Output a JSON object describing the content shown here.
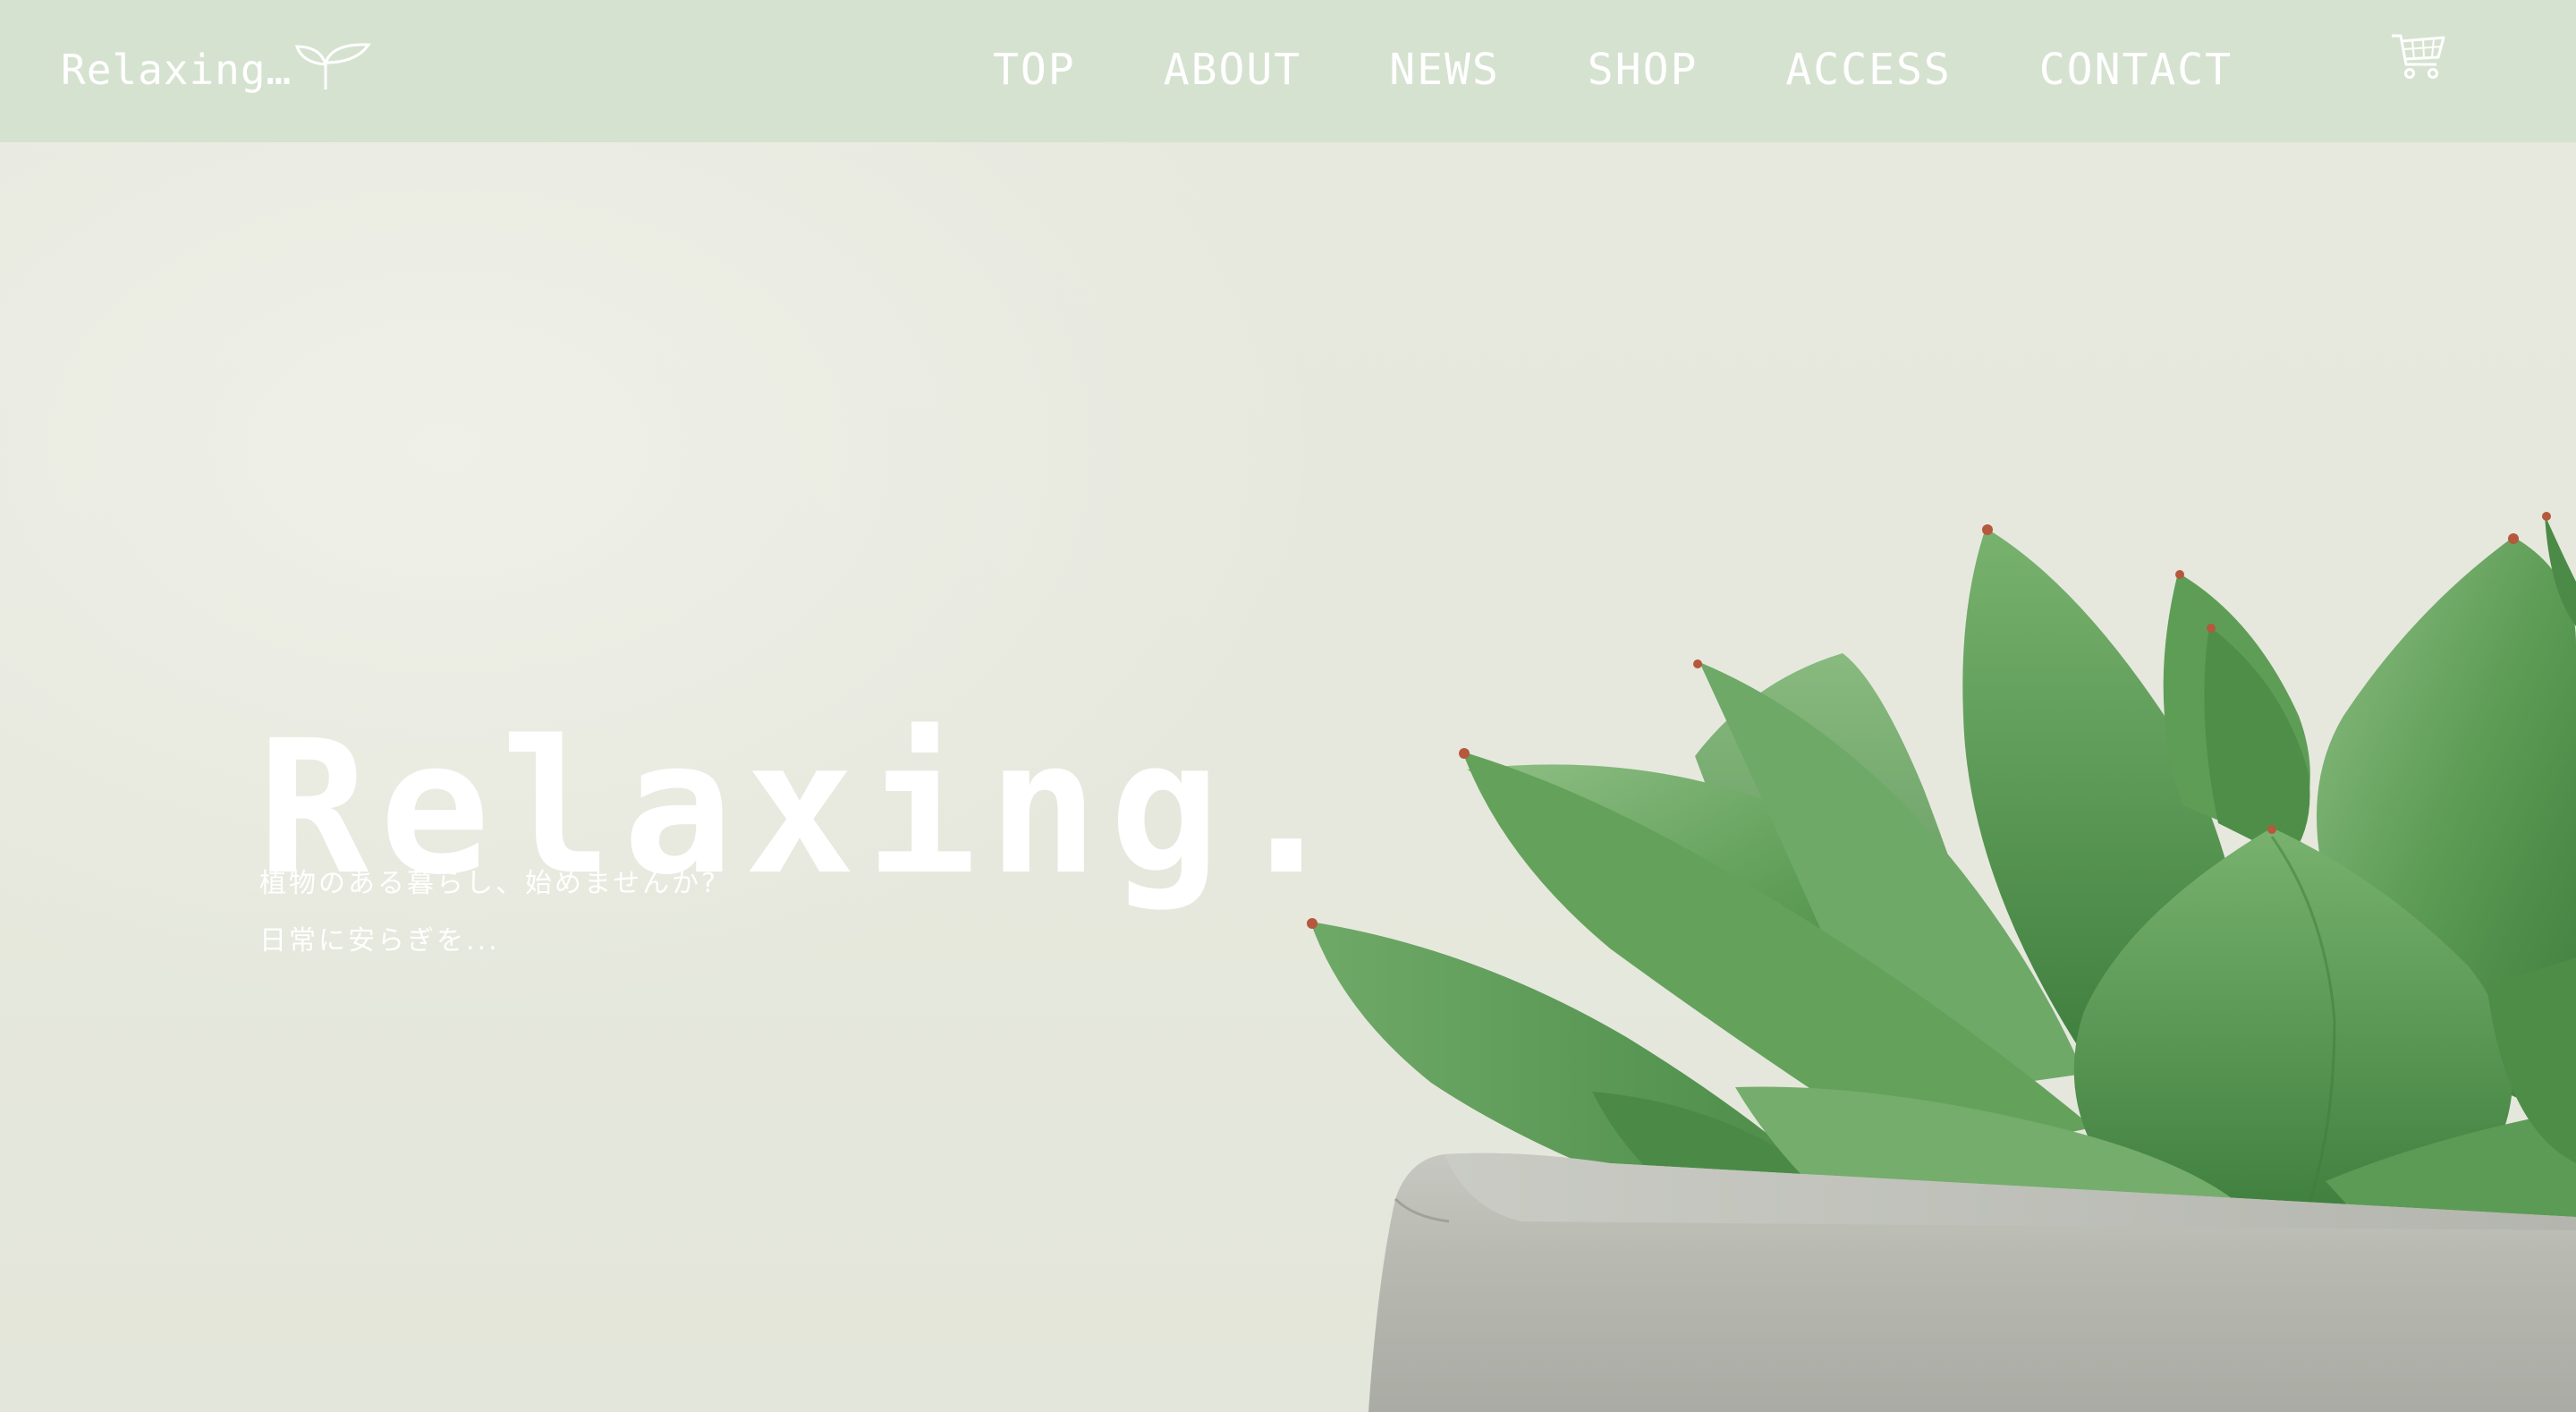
{
  "site": {
    "logo_text": "Relaxing…"
  },
  "nav": {
    "items": [
      {
        "label": "TOP"
      },
      {
        "label": "ABOUT"
      },
      {
        "label": "NEWS"
      },
      {
        "label": "SHOP"
      },
      {
        "label": "ACCESS"
      },
      {
        "label": "CONTACT"
      }
    ],
    "cart_icon": "shopping-cart-icon"
  },
  "hero": {
    "title": "Relaxing.",
    "subtitle_line1": "植物のある暮らし、始めませんか?",
    "subtitle_line2": "日常に安らぎを..."
  },
  "colors": {
    "header_bg": "#d6e2d0",
    "hero_bg": "#e8eae0",
    "text": "#ffffff",
    "plant_green": "#5a9a52",
    "pot_gray": "#b9bcb5"
  }
}
